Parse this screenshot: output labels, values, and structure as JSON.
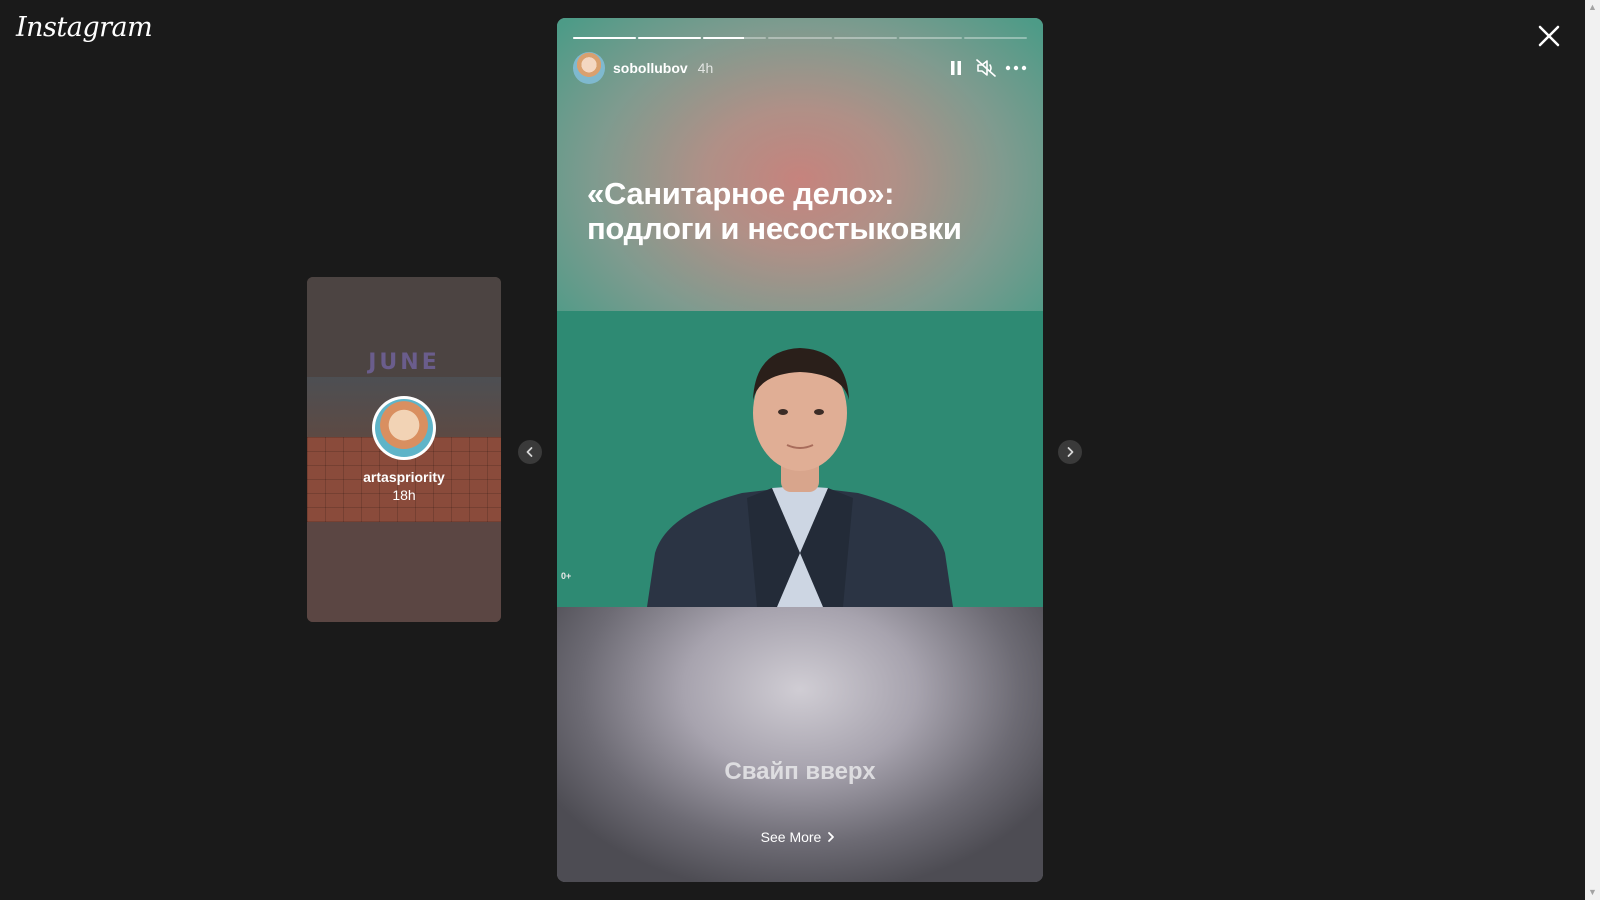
{
  "app": {
    "logo": "Instagram"
  },
  "preview": {
    "sticker": "JUNE",
    "username": "artaspriority",
    "time": "18h"
  },
  "story": {
    "username": "sobollubov",
    "time": "4h",
    "headline": "«Санитарное дело»: подлоги и несостыковки",
    "age_rating": "0+",
    "swipe_text": "Свайп вверх",
    "see_more": "See More",
    "progress": [
      1,
      1,
      0.65,
      0,
      0,
      0,
      0
    ]
  },
  "colors": {
    "background": "#1a1a1a",
    "video_bg": "#2e8a73",
    "text": "#ffffff"
  },
  "icons": [
    "close-icon",
    "chevron-left-icon",
    "chevron-right-icon",
    "pause-icon",
    "muted-icon",
    "more-icon",
    "chevron-right-small-icon"
  ]
}
